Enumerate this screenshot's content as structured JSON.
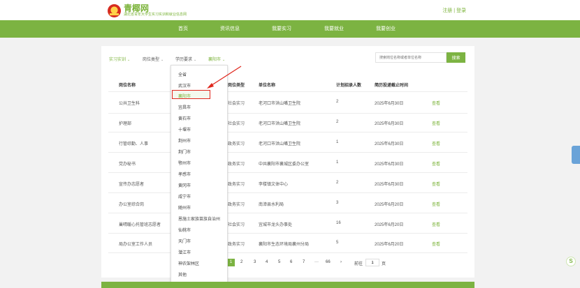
{
  "brand": {
    "title": "青椰网",
    "subtitle": "湖北省青年大学生实习实训和就业信息网"
  },
  "auth": {
    "register": "注册",
    "separator": " | ",
    "login": "登录"
  },
  "nav": [
    "首页",
    "资讯信息",
    "我要实习",
    "我要就业",
    "我要创业"
  ],
  "filters": {
    "f1": "实习实训",
    "f2": "岗位类型",
    "f3": "学历要求",
    "f4": "襄阳市",
    "chevron": "⌄"
  },
  "search": {
    "placeholder": "搜索岗位名称或者单位名称",
    "button": "搜索"
  },
  "table": {
    "headers": [
      "岗位名称",
      "岗位类型",
      "单位名称",
      "计划招录人数",
      "简历投递截止时间"
    ],
    "rows": [
      [
        "公共卫生科",
        "社会实习",
        "老河口市洪山嘴卫生院",
        "2",
        "2025年6月30日",
        "查看"
      ],
      [
        "护理部",
        "社会实习",
        "老河口市洪山嘴卫生院",
        "2",
        "2025年6月30日",
        "查看"
      ],
      [
        "行管综勤、人事",
        "政务实习",
        "老河口市洪山嘴卫生院",
        "1",
        "2025年6月30日",
        "查看"
      ],
      [
        "党办秘书",
        "政务实习",
        "中共襄阳市襄城区委办公室",
        "1",
        "2025年6月30日",
        "查看"
      ],
      [
        "宣传办志愿者",
        "政务实习",
        "李楼镇文体中心",
        "2",
        "2025年6月30日",
        "查看"
      ],
      [
        "办公室综合岗",
        "政务实习",
        "南漳县水利局",
        "3",
        "2025年6月20日",
        "查看"
      ],
      [
        "巢晴暖心托管班志愿者",
        "社会实习",
        "宜城市龙头办事处",
        "16",
        "2025年6月20日",
        "查看"
      ],
      [
        "局办公室工作人员",
        "政务实习",
        "襄阳市生态环境局襄州分局",
        "5",
        "2025年6月20日",
        "查看"
      ]
    ]
  },
  "dropdown": {
    "items": [
      "全省",
      "武汉市",
      "襄阳市",
      "宜昌市",
      "黄石市",
      "十堰市",
      "荆州市",
      "荆门市",
      "鄂州市",
      "孝感市",
      "黄冈市",
      "咸宁市",
      "随州市",
      "恩施土家族苗族自治州",
      "仙桃市",
      "天门市",
      "潜江市",
      "神农架林区",
      "其他"
    ]
  },
  "pagination": {
    "pages": [
      "1",
      "2",
      "3",
      "4",
      "5",
      "6",
      "7",
      "···",
      "66"
    ],
    "next": "›",
    "goto_label": "前往",
    "goto_value": "1",
    "page_unit": "页"
  },
  "colors": {
    "brand_green": "#7cb342",
    "highlight_red": "#e0281e"
  },
  "float_button_icon": "S"
}
